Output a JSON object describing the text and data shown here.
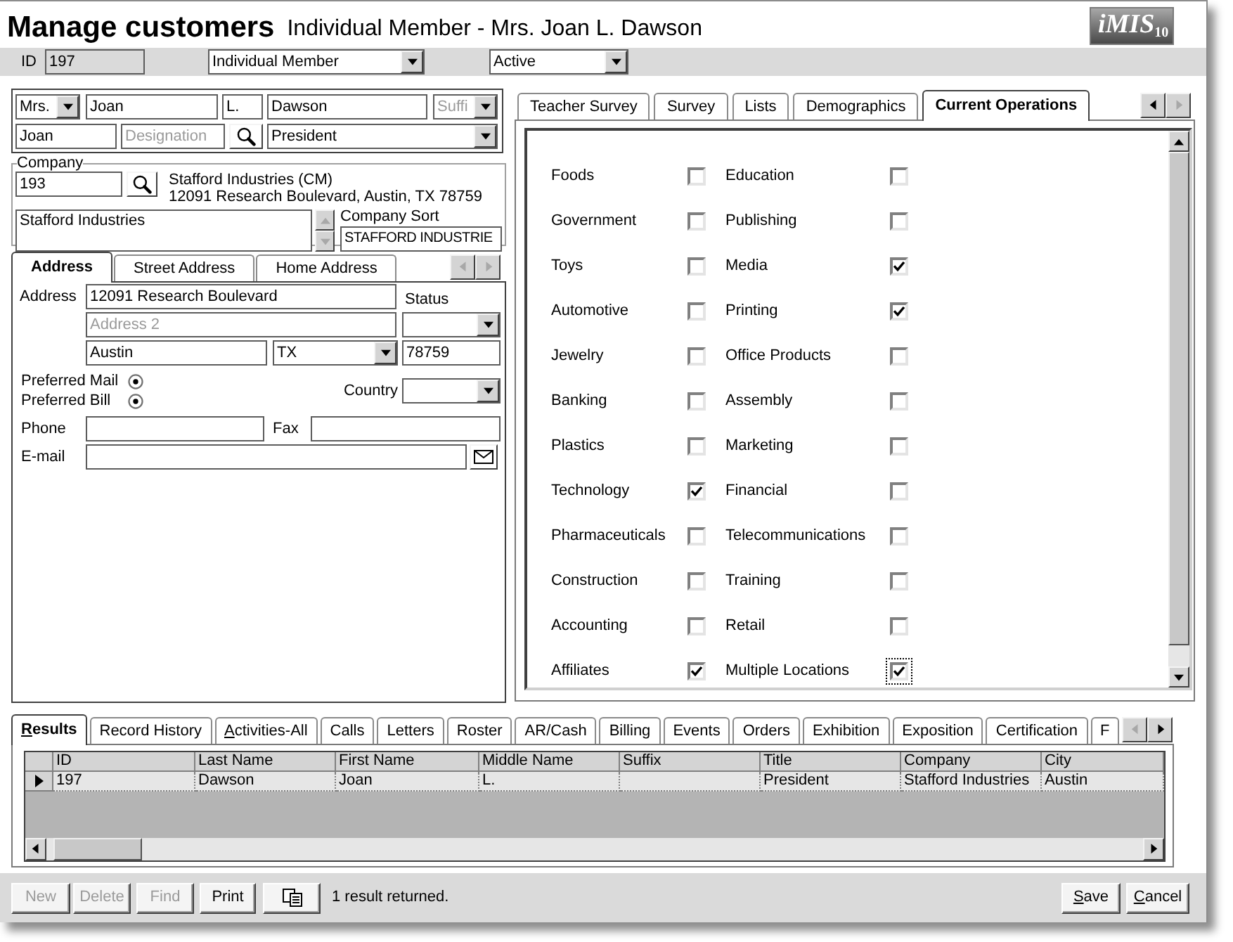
{
  "window": {
    "title": "Manage customers",
    "subtitle": "Individual Member - Mrs. Joan L. Dawson",
    "logo": "iMIS$_{10}$"
  },
  "record": {
    "id_label": "ID",
    "id": "197",
    "member_type": "Individual Member",
    "status": "Active"
  },
  "name": {
    "prefix": "Mrs.",
    "first_name": "Joan",
    "middle_name": "L.",
    "last_name": "Dawson",
    "suffix": {
      "placeholder": "Suffi"
    },
    "informal_name": "Joan",
    "designation": {
      "placeholder": "Designation"
    },
    "title": "President"
  },
  "company": {
    "legend": "Company",
    "id": "193",
    "display_name": "Stafford Industries (CM)",
    "display_address": "12091 Research Boulevard, Austin, TX 78759",
    "name": "Stafford Industries",
    "sort_label": "Company Sort",
    "sort": "STAFFORD INDUSTRIE"
  },
  "address_tabs": {
    "tabs": [
      {
        "label": "Address",
        "selected": true
      },
      {
        "label": "Street Address",
        "selected": false
      },
      {
        "label": "Home Address",
        "selected": false
      }
    ],
    "back_disabled": true,
    "forward_disabled": true
  },
  "address": {
    "address_label": "Address",
    "line_1": "12091 Research Boulevard",
    "line_2": {
      "placeholder": "Address 2"
    },
    "status_label": "Status",
    "city": "Austin",
    "state": "TX",
    "zip": "78759",
    "preferences": [
      {
        "label": "Preferred Mail",
        "checked": true
      },
      {
        "label": "Preferred Bill",
        "checked": true
      }
    ],
    "country_label": "Country",
    "phone_label": "Phone",
    "fax_label": "Fax",
    "email_label": "E-mail"
  },
  "profile_tabs": {
    "tabs": [
      {
        "label": "Teacher Survey",
        "selected": false
      },
      {
        "label": "Survey",
        "selected": false
      },
      {
        "label": "Lists",
        "selected": false
      },
      {
        "label": "Demographics",
        "selected": false
      },
      {
        "label": "Current Operations",
        "selected": true
      }
    ],
    "back_disabled": false,
    "forward_disabled": true
  },
  "current_operations": [
    {
      "label": "Foods",
      "checked": false,
      "focused": false
    },
    {
      "label": "Education",
      "checked": false,
      "focused": false
    },
    {
      "label": "Government",
      "checked": false,
      "focused": false
    },
    {
      "label": "Publishing",
      "checked": false,
      "focused": false
    },
    {
      "label": "Toys",
      "checked": false,
      "focused": false
    },
    {
      "label": "Media",
      "checked": true,
      "focused": false
    },
    {
      "label": "Automotive",
      "checked": false,
      "focused": false
    },
    {
      "label": "Printing",
      "checked": true,
      "focused": false
    },
    {
      "label": "Jewelry",
      "checked": false,
      "focused": false
    },
    {
      "label": "Office Products",
      "checked": false,
      "focused": false
    },
    {
      "label": "Banking",
      "checked": false,
      "focused": false
    },
    {
      "label": "Assembly",
      "checked": false,
      "focused": false
    },
    {
      "label": "Plastics",
      "checked": false,
      "focused": false
    },
    {
      "label": "Marketing",
      "checked": false,
      "focused": false
    },
    {
      "label": "Technology",
      "checked": true,
      "focused": false
    },
    {
      "label": "Financial",
      "checked": false,
      "focused": false
    },
    {
      "label": "Pharmaceuticals",
      "checked": false,
      "focused": false
    },
    {
      "label": "Telecommunications",
      "checked": false,
      "focused": false
    },
    {
      "label": "Construction",
      "checked": false,
      "focused": false
    },
    {
      "label": "Training",
      "checked": false,
      "focused": false
    },
    {
      "label": "Accounting",
      "checked": false,
      "focused": false
    },
    {
      "label": "Retail",
      "checked": false,
      "focused": false
    },
    {
      "label": "Affiliates",
      "checked": true,
      "focused": false
    },
    {
      "label": "Multiple Locations",
      "checked": true,
      "focused": true
    }
  ],
  "result_tabs": {
    "tabs": [
      {
        "label": "Results",
        "selected": true,
        "mnemonic": true
      },
      {
        "label": "Record History",
        "selected": false,
        "mnemonic": false
      },
      {
        "label": "Activities-All",
        "selected": false,
        "mnemonic": true
      },
      {
        "label": "Calls",
        "selected": false,
        "mnemonic": false
      },
      {
        "label": "Letters",
        "selected": false,
        "mnemonic": false
      },
      {
        "label": "Roster",
        "selected": false,
        "mnemonic": false
      },
      {
        "label": "AR/Cash",
        "selected": false,
        "mnemonic": false
      },
      {
        "label": "Billing",
        "selected": false,
        "mnemonic": false
      },
      {
        "label": "Events",
        "selected": false,
        "mnemonic": false
      },
      {
        "label": "Orders",
        "selected": false,
        "mnemonic": false
      },
      {
        "label": "Exhibition",
        "selected": false,
        "mnemonic": false
      },
      {
        "label": "Exposition",
        "selected": false,
        "mnemonic": false
      },
      {
        "label": "Certification",
        "selected": false,
        "mnemonic": false
      },
      {
        "label": "F",
        "selected": false,
        "mnemonic": false
      }
    ],
    "back_disabled": true,
    "forward_disabled": false
  },
  "results_table": {
    "columns": [
      "ID",
      "Last Name",
      "First Name",
      "Middle Name",
      "Suffix",
      "Title",
      "Company",
      "City"
    ],
    "rows": [
      {
        "current": true,
        "cells": [
          "197",
          "Dawson",
          "Joan",
          "L.",
          null,
          "President",
          "Stafford Industries",
          "Austin"
        ]
      }
    ]
  },
  "actions": {
    "left": [
      {
        "kind": "text",
        "label": "New",
        "disabled": true,
        "mnemonic": false
      },
      {
        "kind": "text",
        "label": "Delete",
        "disabled": true,
        "mnemonic": false
      },
      {
        "kind": "text",
        "label": "Find",
        "disabled": true,
        "mnemonic": false
      },
      {
        "kind": "text",
        "label": "Print",
        "disabled": false,
        "mnemonic": false
      },
      {
        "kind": "copy",
        "disabled": false
      }
    ],
    "message": "1 result returned.",
    "right": [
      {
        "label": "Save",
        "mnemonic": true
      },
      {
        "label": "Cancel",
        "mnemonic": true
      }
    ]
  }
}
